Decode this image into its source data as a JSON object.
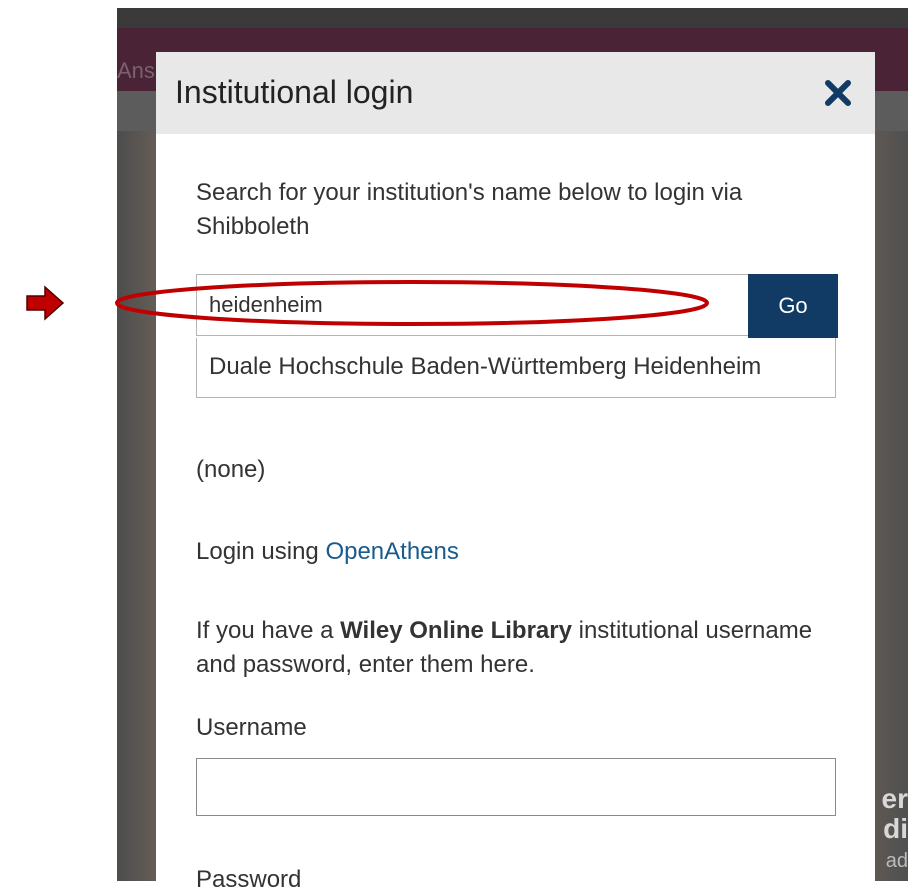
{
  "background": {
    "partial_word": "Ans",
    "right_text_1": "er",
    "right_text_2": "di",
    "right_text_3": "ad"
  },
  "modal": {
    "title": "Institutional login",
    "intro": "Search for your institution's name below to login via Shibboleth",
    "search": {
      "value": "heidenheim",
      "go_label": "Go"
    },
    "suggestion": "Duale Hochschule Baden-Württemberg Heidenheim",
    "none_text": "(none)",
    "openathens": {
      "prefix": "Login using ",
      "link": "OpenAthens"
    },
    "wiley": {
      "prefix": "If you have a ",
      "bold": "Wiley Online Library",
      "suffix": " institutional username and password, enter them here."
    },
    "username_label": "Username",
    "password_label": "Password"
  },
  "colors": {
    "go_button": "#113a64",
    "link": "#1a5b8c",
    "annotation": "#c00000"
  }
}
